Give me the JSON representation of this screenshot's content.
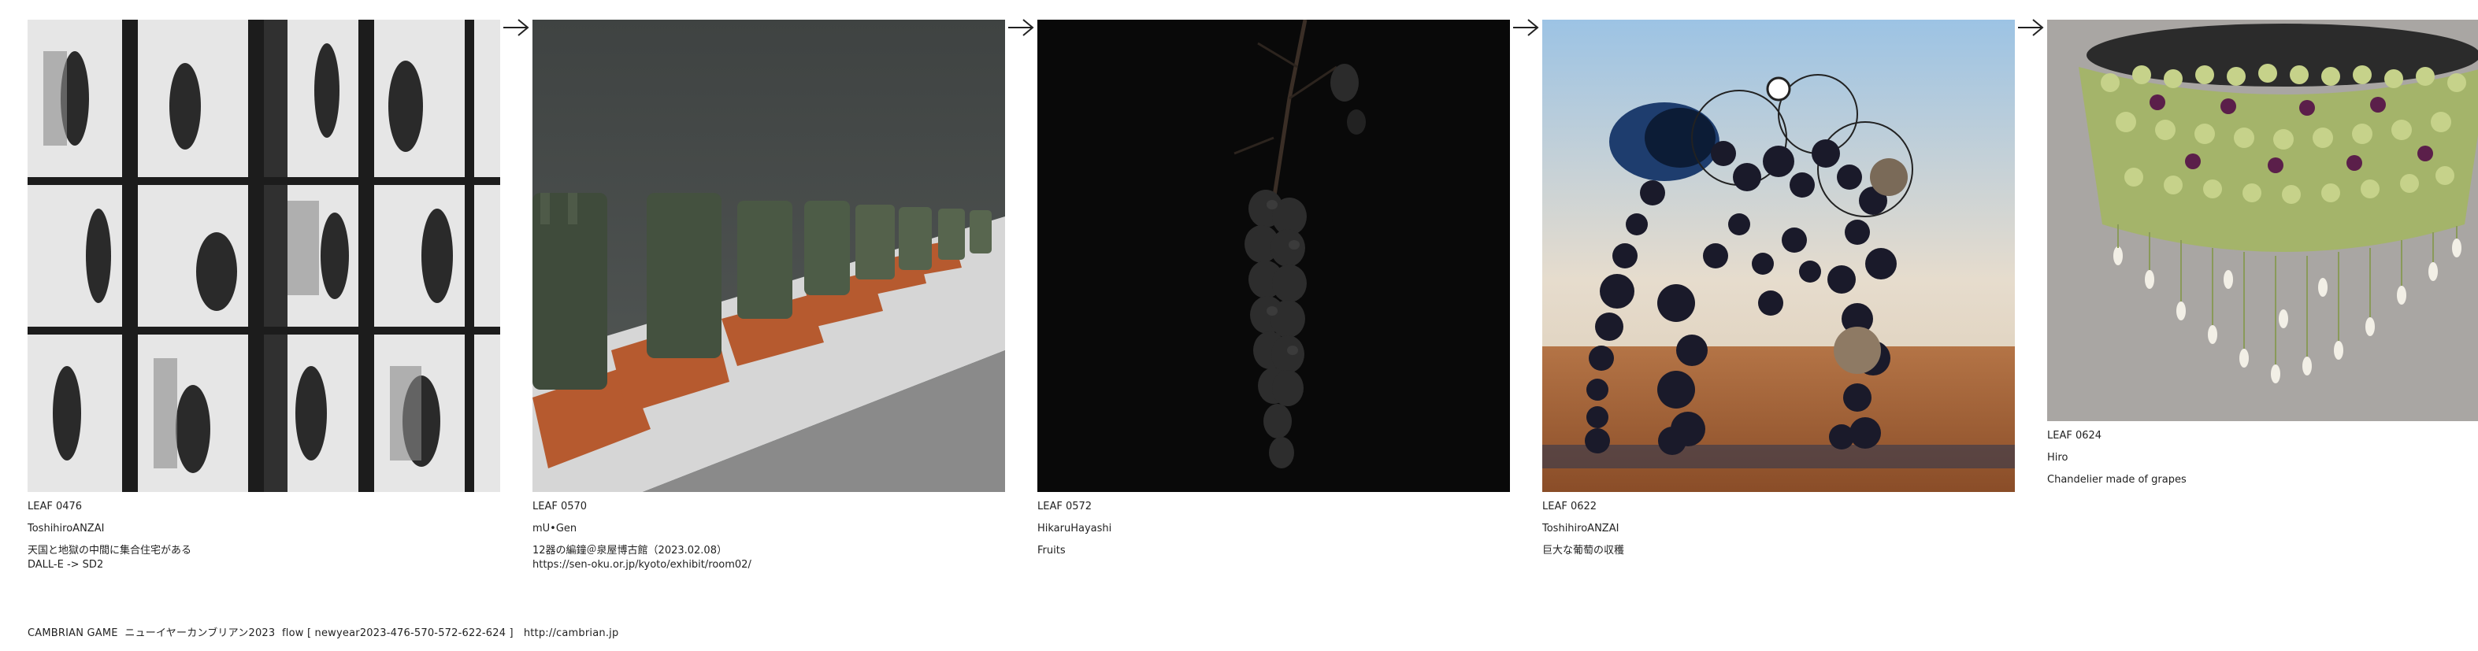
{
  "flow": {
    "arrow_icon": "arrow-right-icon",
    "leaves": [
      {
        "id": "LEAF 0476",
        "author": "ToshihiroANZAI",
        "description": "天国と地獄の中間に集合住宅がある\nDALL-E -> SD2",
        "image": "grid of translucent rooms with silhouettes"
      },
      {
        "id": "LEAF 0570",
        "author": "mU•Gen",
        "description": "12器の編鐘＠泉屋博古館（2023.02.08）\nhttps://sen-oku.or.jp/kyoto/exhibit/room02/",
        "image": "row of bronze bells on wooden stands"
      },
      {
        "id": "LEAF 0572",
        "author": "HikaruHayashi",
        "description": "Fruits",
        "image": "dark hanging fruit cluster"
      },
      {
        "id": "LEAF 0622",
        "author": "ToshihiroANZAI",
        "description": "巨大な葡萄の収穫",
        "image": "giant grape sculpture in field"
      },
      {
        "id": "LEAF 0624",
        "author": "Hiro",
        "description": "Chandelier made of grapes",
        "image": "grape chandelier"
      }
    ]
  },
  "footer": {
    "text": "CAMBRIAN GAME  ニューイヤーカンブリアン2023  flow [ newyear2023-476-570-572-622-624 ]   http://cambrian.jp"
  }
}
